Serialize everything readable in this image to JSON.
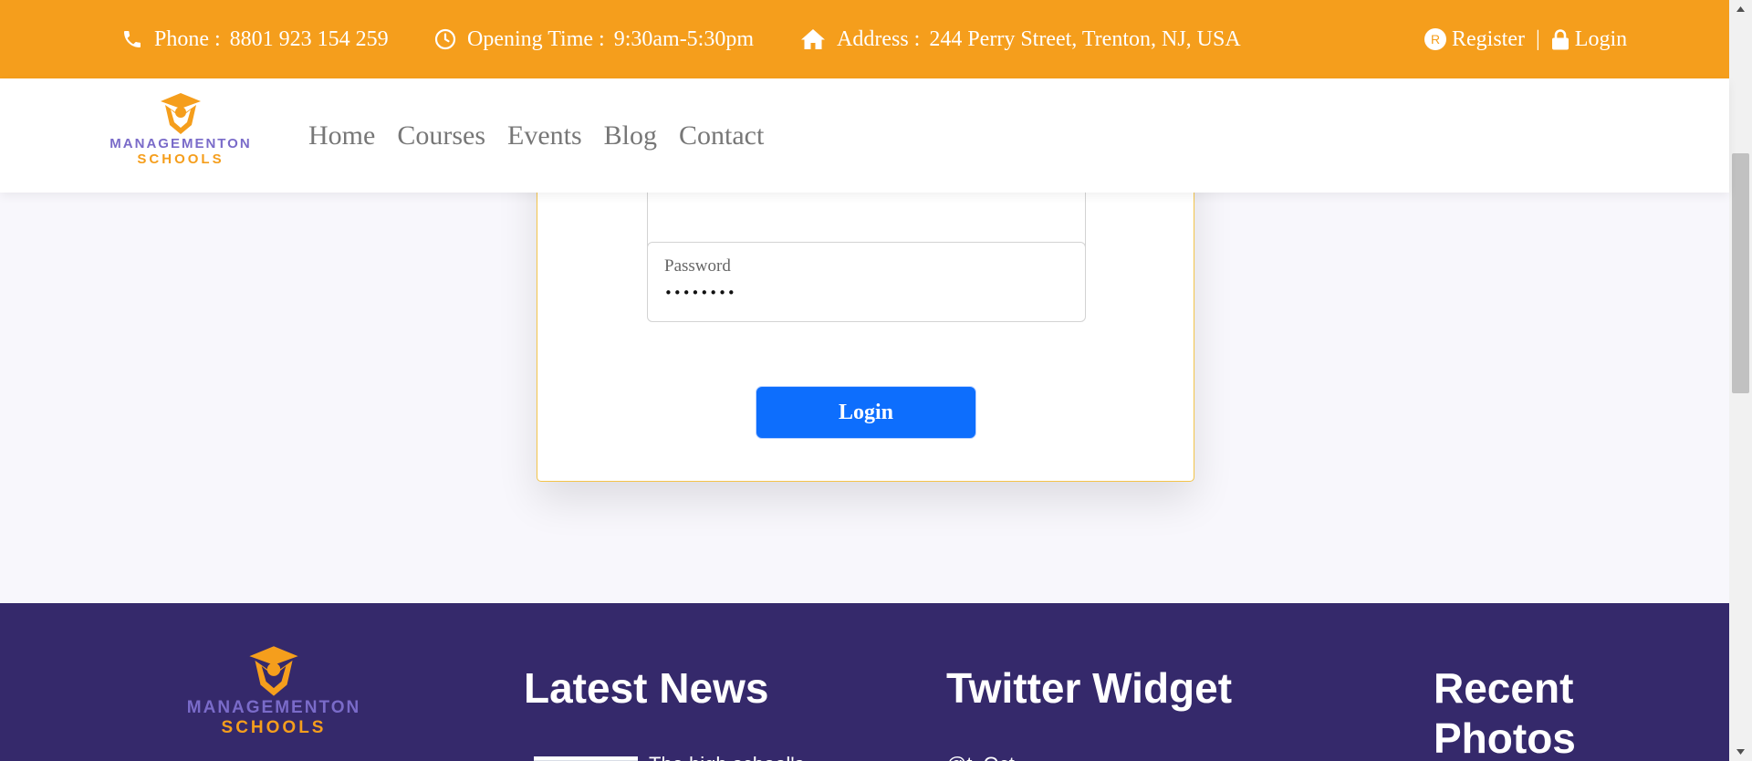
{
  "topbar": {
    "phone": {
      "icon": "phone-icon",
      "label": "Phone :",
      "value": "8801 923 154 259"
    },
    "hours": {
      "icon": "clock-icon",
      "label": "Opening Time :",
      "value": "9:30am-5:30pm"
    },
    "address": {
      "icon": "home-icon",
      "label": "Address :",
      "value": "244 Perry Street, Trenton, NJ, USA"
    },
    "register": {
      "icon": "registered-icon",
      "badge": "R",
      "label": "Register"
    },
    "separator": "|",
    "login": {
      "icon": "lock-icon",
      "label": "Login"
    }
  },
  "brand": {
    "line1": "MANAGEMENTON",
    "line2": "SCHOOLS"
  },
  "nav": {
    "items": [
      {
        "label": "Home"
      },
      {
        "label": "Courses"
      },
      {
        "label": "Events"
      },
      {
        "label": "Blog"
      },
      {
        "label": "Contact"
      }
    ]
  },
  "login_form": {
    "password_label": "Password",
    "password_value": "••••••••",
    "submit_label": "Login"
  },
  "footer": {
    "latest_news_title": "Latest News",
    "latest_news_snippet": "The high school's ",
    "twitter_title": "Twitter Widget",
    "twitter_snippet": "@t_Oct ",
    "recent_photos_title": "Recent Photos"
  },
  "colors": {
    "topbar_bg": "#f59e1c",
    "footer_bg": "#35296b",
    "button_bg": "#0d6efd",
    "brand_purple": "#7a6bc9",
    "brand_orange": "#f59e1c",
    "card_border": "#f3c44b"
  }
}
